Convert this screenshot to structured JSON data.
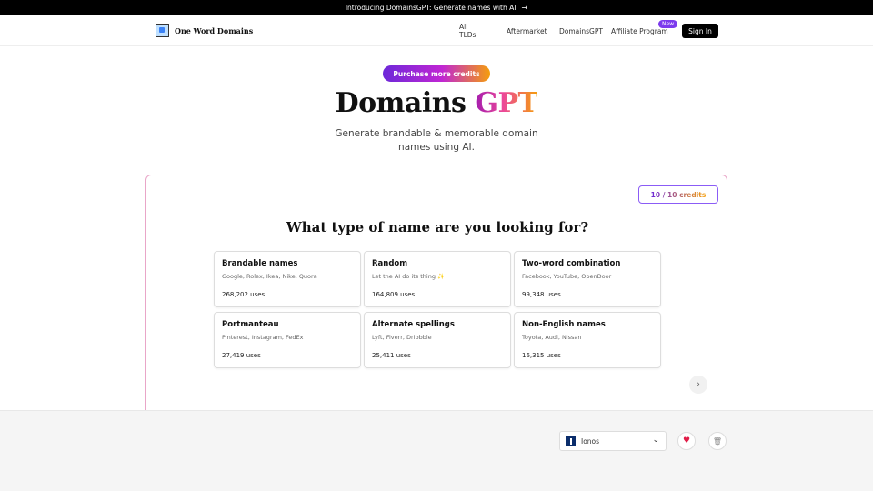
{
  "banner": {
    "text": "Introducing DomainsGPT: Generate names with AI",
    "arrow_icon": "arrow-right-icon"
  },
  "nav": {
    "logo_text": "One Word Domains",
    "links": [
      "All TLDs",
      "Aftermarket",
      "DomainsGPT",
      "Affiliate Program"
    ],
    "new_badge": "New",
    "signin": "Sign In"
  },
  "hero": {
    "purchase_button": "Purchase more credits",
    "title_main": "Domains",
    "title_accent": "GPT",
    "subtitle": "Generate brandable & memorable domain names using AI."
  },
  "generator": {
    "credits": "10 / 10 credits",
    "question": "What type of name are you looking for?",
    "options": [
      {
        "title": "Brandable names",
        "examples": "Google, Rolex, Ikea, Nike, Quora",
        "uses": "268,202 uses"
      },
      {
        "title": "Random",
        "examples": "Let the AI do its thing ✨",
        "uses": "164,809 uses"
      },
      {
        "title": "Two-word combination",
        "examples": "Facebook, YouTube, OpenDoor",
        "uses": "99,348 uses"
      },
      {
        "title": "Portmanteau",
        "examples": "Pinterest, Instagram, FedEx",
        "uses": "27,419 uses"
      },
      {
        "title": "Alternate spellings",
        "examples": "Lyft, Fiverr, Dribbble",
        "uses": "25,411 uses"
      },
      {
        "title": "Non-English names",
        "examples": "Toyota, Audi, Nissan",
        "uses": "16,315 uses"
      }
    ],
    "next_icon": "chevron-right-icon"
  },
  "footer_bar": {
    "registrar": "Ionos",
    "heart_icon": "heart-icon",
    "trash_icon": "trash-icon"
  }
}
